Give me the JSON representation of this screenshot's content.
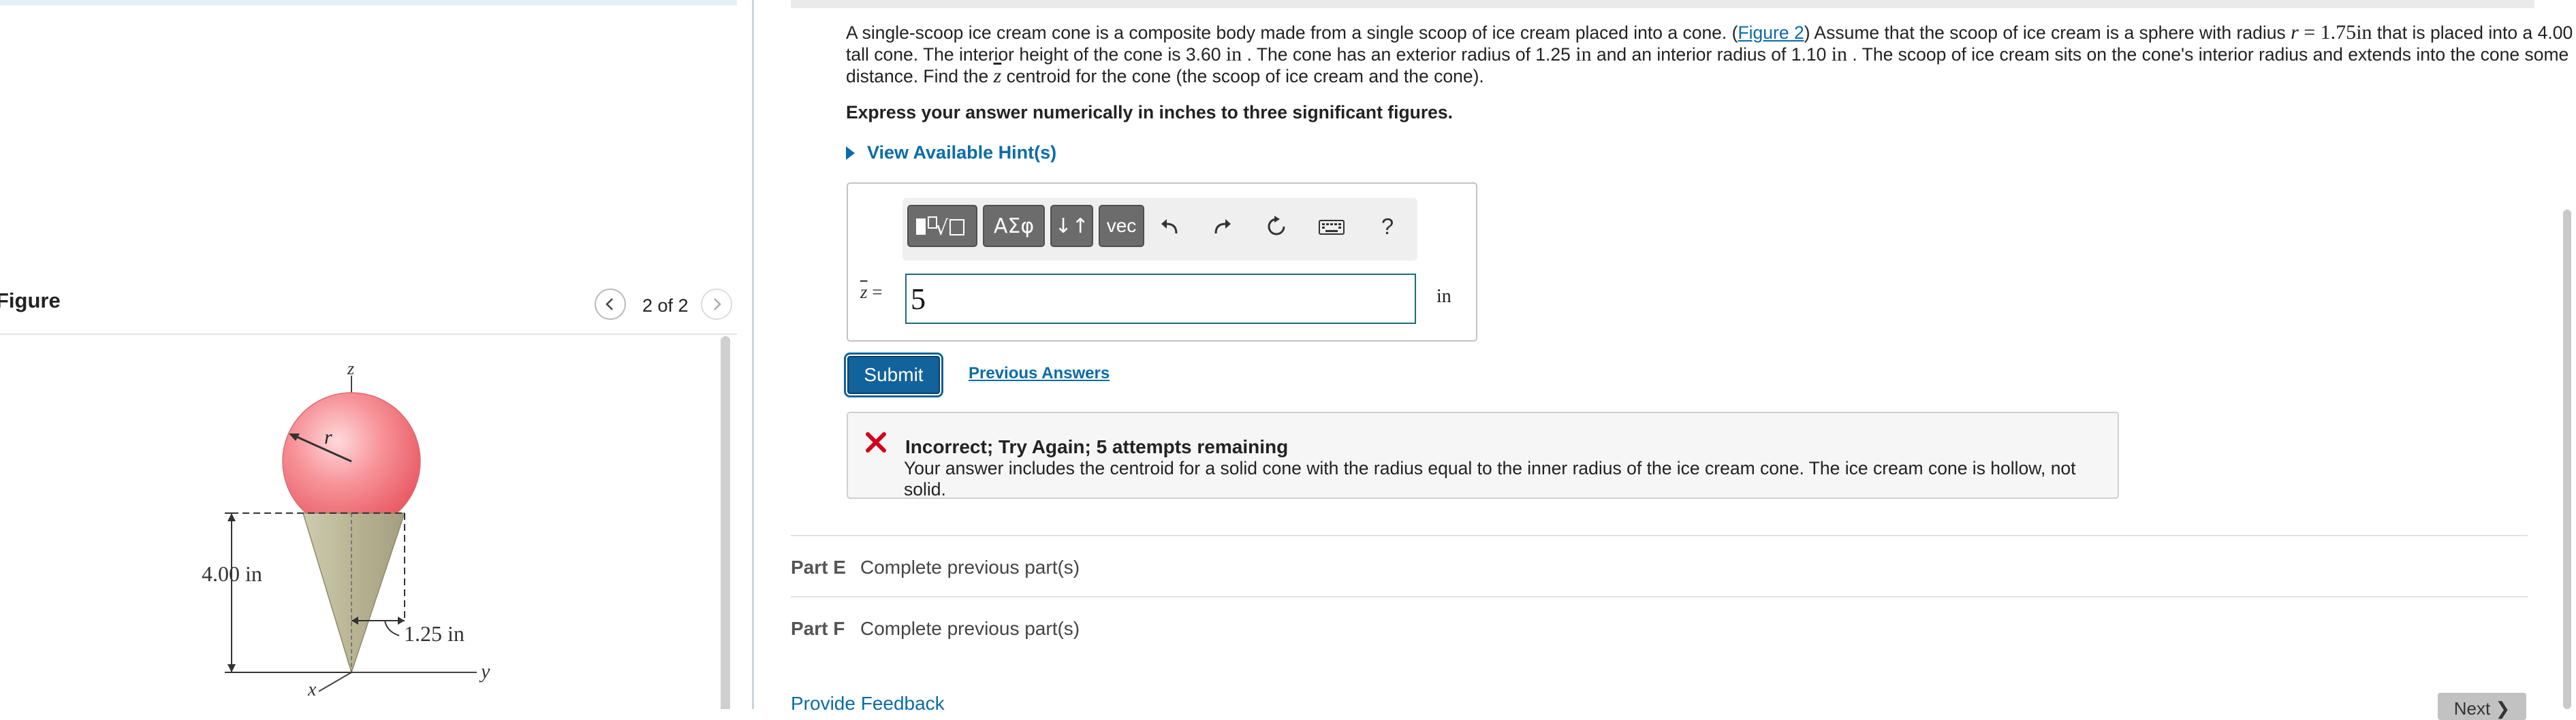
{
  "figure_panel": {
    "title": "Figure",
    "pager": "2 of 2",
    "labels": {
      "z_axis": "z",
      "y_axis": "y",
      "x_axis": "x",
      "radius": "r",
      "height": "4.00 in",
      "cone_radius": "1.25 in"
    }
  },
  "question": {
    "text_a": "A single-scoop ice cream cone is a composite body made from a single scoop of ice cream placed into a cone. (",
    "figure_link": "Figure 2",
    "text_b": ") Assume that the scoop of ice cream is a sphere with radius ",
    "r_var": "r",
    "eq": " = 1.75",
    "unit_in": "in",
    "text_c": " that is placed into a 4.00 ",
    "text_d": " tall cone. The interior height of the cone is 3.60 ",
    "text_e": " . The cone has an exterior radius of 1.25 ",
    "text_f": " and an interior radius of 1.10 ",
    "text_g": " . The scoop of ice cream sits on the cone's interior radius and extends into the cone some distance. Find the ",
    "zbar": "z",
    "text_h": " centroid for the cone (the scoop of ice cream and the cone).",
    "instruction": "Express your answer numerically in inches to three significant figures.",
    "hints": "View Available Hint(s)"
  },
  "toolbar": {
    "greek": "ΑΣφ",
    "updown": "↓↑",
    "vec": "vec",
    "help": "?",
    "icons": [
      "templates-icon",
      "undo-icon",
      "redo-icon",
      "reset-icon",
      "keyboard-icon",
      "help-icon"
    ]
  },
  "answer": {
    "var_eq": " =",
    "var": "z",
    "value": "5",
    "unit": "in"
  },
  "actions": {
    "submit": "Submit",
    "previous_answers": "Previous Answers"
  },
  "feedback": {
    "title": "Incorrect; Try Again; 5 attempts remaining",
    "message": "Your answer includes the centroid for a solid cone with the radius equal to the inner radius of the ice cream cone. The ice cream cone is hollow, not solid.",
    "color": "#d0021b"
  },
  "parts": [
    {
      "label": "Part E",
      "status": "Complete previous part(s)"
    },
    {
      "label": "Part F",
      "status": "Complete previous part(s)"
    }
  ],
  "footer": {
    "provide_feedback": "Provide Feedback",
    "next": "Next ❯"
  },
  "colors": {
    "link": "#0a6ca8",
    "submit": "#12629c",
    "scoop": "#f26a72",
    "cone": "#b7b392"
  }
}
